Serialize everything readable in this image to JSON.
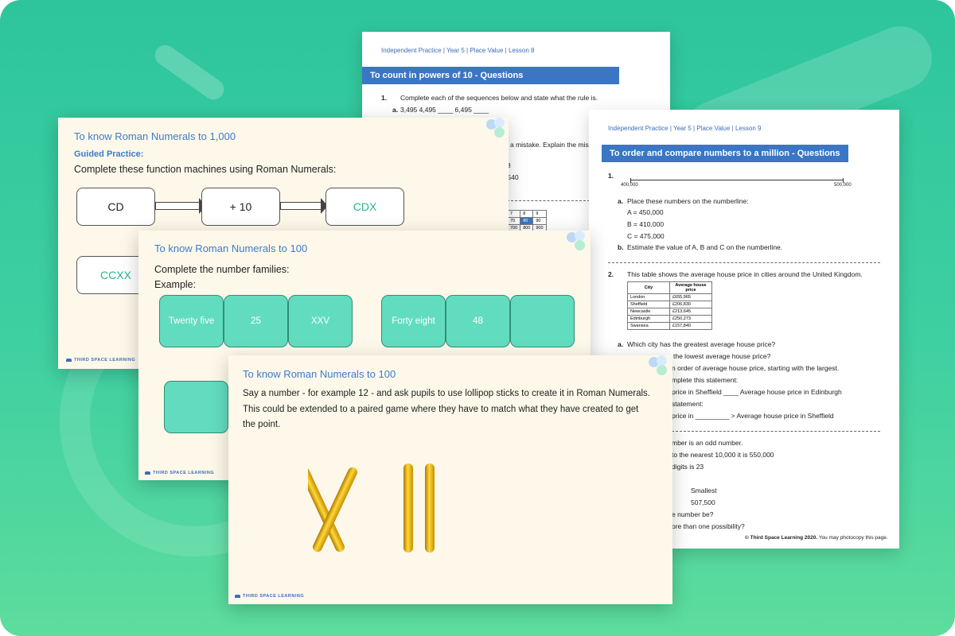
{
  "colors": {
    "background": "#3fd0a1",
    "accent_blue": "#3a76c4",
    "tile_green": "#62dcbf",
    "slide_bg": "#fdf8ea"
  },
  "worksheet_powers": {
    "header": "Independent Practice | Year 5 | Place Value | Lesson 8",
    "title": "To count in powers of 10 - Questions",
    "q1_num": "1.",
    "q1_text": "Complete each of the sequences below and state what the rule is.",
    "q1a_label": "a.",
    "q1a_text": "3,495   4,495   ____   6,495   ____",
    "frag1": "a mistake. Explain the mist",
    "frag2": "8",
    "frag3": ",540",
    "grid": [
      [
        "7",
        "8",
        "9"
      ],
      [
        "70",
        "80",
        "90"
      ],
      [
        "700",
        "800",
        "900"
      ]
    ]
  },
  "worksheet_order": {
    "header": "Independent Practice | Year 5 | Place Value | Lesson 9",
    "title": "To order and compare numbers to a million - Questions",
    "q1_num": "1.",
    "numberline_start": "400,000",
    "numberline_end": "500,000",
    "qa_label": "a.",
    "qa_text": "Place these numbers on the numberline:",
    "values": [
      "A = 450,000",
      "B = 410,000",
      "C = 475,000"
    ],
    "qb_label": "b.",
    "qb_text": "Estimate the value of A, B and C on the numberline.",
    "q2_num": "2.",
    "q2_text": "This table shows the average house price in cities around the United Kingdom.",
    "table_headers": [
      "City",
      "Average house price"
    ],
    "table_rows": [
      [
        "London",
        "£655,965"
      ],
      [
        "Sheffield",
        "£206,830"
      ],
      [
        "Newcastle",
        "£213,645"
      ],
      [
        "Edinburgh",
        "£250,273"
      ],
      [
        "Swansea",
        "£157,840"
      ]
    ],
    "q2a_label": "a.",
    "q2a_text": "Which city has the greatest average house price?",
    "lines": [
      "the lowest average house price?",
      "n order of average house price, starting with the largest.",
      "mplete this statement:",
      "price in Sheffield ____ Average house price in Edinburgh",
      "statement:",
      "price in _________ > Average house price in Sheffield",
      "mber is an odd number.",
      "to the nearest 10,000 it is 550,000",
      "digits is 23",
      "Smallest",
      "507,500",
      "e number be?",
      "ore than one possibility?"
    ],
    "copyright": "© Third Space Learning 2020.",
    "copyright_rest": "You may photocopy this page."
  },
  "slide_function": {
    "title": "To know Roman Numerals to 1,000",
    "subtitle": "Guided Practice:",
    "instruction": "Complete these function machines using Roman Numerals:",
    "box1": "CD",
    "box2": "+ 10",
    "box3": "CDX",
    "box4": "CCXX",
    "logo": "THIRD SPACE LEARNING"
  },
  "slide_families": {
    "title": "To know Roman Numerals to 100",
    "instruction": "Complete the number families:",
    "example": "Example:",
    "tiles_left": [
      "Twenty five",
      "25",
      "XXV"
    ],
    "tiles_right": [
      "Forty eight",
      "48",
      ""
    ],
    "logo": "THIRD SPACE LEARNING"
  },
  "slide_lollipop": {
    "title": "To know Roman Numerals to 100",
    "line1": "Say a number - for example 12 - and ask pupils to use lollipop sticks to create it in Roman Numerals.",
    "line2": "This could be extended to a paired game where they have to match what they have created to get",
    "line3": "the point.",
    "logo": "THIRD SPACE LEARNING"
  }
}
